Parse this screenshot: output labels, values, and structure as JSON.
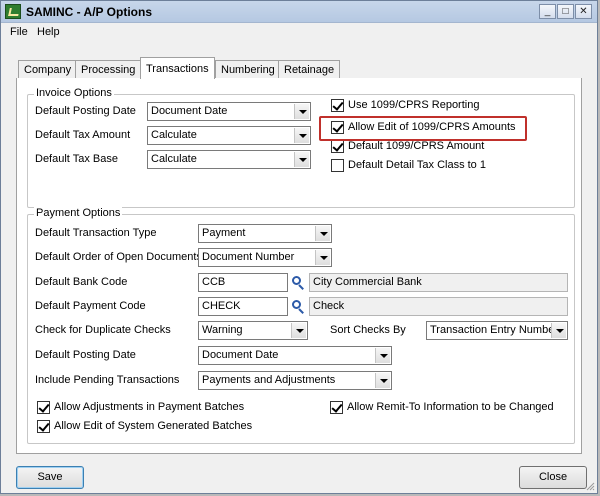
{
  "window": {
    "title": "SAMINC - A/P Options",
    "controls": {
      "minimize": "_",
      "maximize": "□",
      "close": "✕"
    }
  },
  "menu": [
    "File",
    "Help"
  ],
  "tabs": [
    "Company",
    "Processing",
    "Transactions",
    "Numbering",
    "Retainage"
  ],
  "active_tab": "Transactions",
  "invoice_options": {
    "title": "Invoice Options",
    "fields": [
      {
        "label": "Default Posting Date",
        "value": "Document Date"
      },
      {
        "label": "Default Tax Amount",
        "value": "Calculate"
      },
      {
        "label": "Default Tax Base",
        "value": "Calculate"
      }
    ],
    "checkboxes": [
      {
        "label": "Use 1099/CPRS Reporting",
        "checked": true
      },
      {
        "label": "Allow Edit of 1099/CPRS Amounts",
        "checked": true
      },
      {
        "label": "Default 1099/CPRS Amount",
        "checked": true
      },
      {
        "label": "Default Detail Tax Class to 1",
        "checked": false
      }
    ]
  },
  "payment_options": {
    "title": "Payment Options",
    "transaction_type": {
      "label": "Default Transaction Type",
      "value": "Payment"
    },
    "order_open_docs": {
      "label": "Default Order of Open Documents",
      "value": "Document Number"
    },
    "bank_code": {
      "label": "Default Bank Code",
      "value": "CCB",
      "description": "City Commercial Bank"
    },
    "payment_code": {
      "label": "Default Payment Code",
      "value": "CHECK",
      "description": "Check"
    },
    "duplicate_checks": {
      "label": "Check for Duplicate Checks",
      "value": "Warning"
    },
    "sort_checks": {
      "label": "Sort Checks By",
      "value": "Transaction Entry Number"
    },
    "posting_date": {
      "label": "Default Posting Date",
      "value": "Document Date"
    },
    "pending": {
      "label": "Include Pending Transactions",
      "value": "Payments and Adjustments"
    },
    "checkboxes": [
      {
        "label": "Allow Adjustments in Payment Batches",
        "checked": true
      },
      {
        "label": "Allow Remit-To Information to be Changed",
        "checked": true
      },
      {
        "label": "Allow Edit of System Generated Batches",
        "checked": true
      }
    ]
  },
  "buttons": {
    "save": "Save",
    "close": "Close"
  }
}
